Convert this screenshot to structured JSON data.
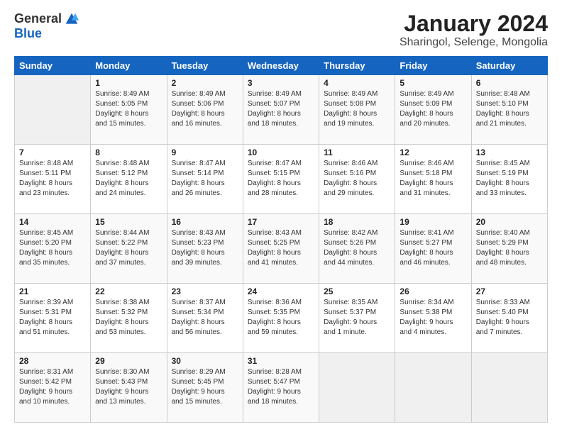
{
  "logo": {
    "general": "General",
    "blue": "Blue"
  },
  "title": "January 2024",
  "subtitle": "Sharingol, Selenge, Mongolia",
  "days_header": [
    "Sunday",
    "Monday",
    "Tuesday",
    "Wednesday",
    "Thursday",
    "Friday",
    "Saturday"
  ],
  "weeks": [
    [
      {
        "num": "",
        "sunrise": "",
        "sunset": "",
        "daylight": ""
      },
      {
        "num": "1",
        "sunrise": "Sunrise: 8:49 AM",
        "sunset": "Sunset: 5:05 PM",
        "daylight": "Daylight: 8 hours and 15 minutes."
      },
      {
        "num": "2",
        "sunrise": "Sunrise: 8:49 AM",
        "sunset": "Sunset: 5:06 PM",
        "daylight": "Daylight: 8 hours and 16 minutes."
      },
      {
        "num": "3",
        "sunrise": "Sunrise: 8:49 AM",
        "sunset": "Sunset: 5:07 PM",
        "daylight": "Daylight: 8 hours and 18 minutes."
      },
      {
        "num": "4",
        "sunrise": "Sunrise: 8:49 AM",
        "sunset": "Sunset: 5:08 PM",
        "daylight": "Daylight: 8 hours and 19 minutes."
      },
      {
        "num": "5",
        "sunrise": "Sunrise: 8:49 AM",
        "sunset": "Sunset: 5:09 PM",
        "daylight": "Daylight: 8 hours and 20 minutes."
      },
      {
        "num": "6",
        "sunrise": "Sunrise: 8:48 AM",
        "sunset": "Sunset: 5:10 PM",
        "daylight": "Daylight: 8 hours and 21 minutes."
      }
    ],
    [
      {
        "num": "7",
        "sunrise": "Sunrise: 8:48 AM",
        "sunset": "Sunset: 5:11 PM",
        "daylight": "Daylight: 8 hours and 23 minutes."
      },
      {
        "num": "8",
        "sunrise": "Sunrise: 8:48 AM",
        "sunset": "Sunset: 5:12 PM",
        "daylight": "Daylight: 8 hours and 24 minutes."
      },
      {
        "num": "9",
        "sunrise": "Sunrise: 8:47 AM",
        "sunset": "Sunset: 5:14 PM",
        "daylight": "Daylight: 8 hours and 26 minutes."
      },
      {
        "num": "10",
        "sunrise": "Sunrise: 8:47 AM",
        "sunset": "Sunset: 5:15 PM",
        "daylight": "Daylight: 8 hours and 28 minutes."
      },
      {
        "num": "11",
        "sunrise": "Sunrise: 8:46 AM",
        "sunset": "Sunset: 5:16 PM",
        "daylight": "Daylight: 8 hours and 29 minutes."
      },
      {
        "num": "12",
        "sunrise": "Sunrise: 8:46 AM",
        "sunset": "Sunset: 5:18 PM",
        "daylight": "Daylight: 8 hours and 31 minutes."
      },
      {
        "num": "13",
        "sunrise": "Sunrise: 8:45 AM",
        "sunset": "Sunset: 5:19 PM",
        "daylight": "Daylight: 8 hours and 33 minutes."
      }
    ],
    [
      {
        "num": "14",
        "sunrise": "Sunrise: 8:45 AM",
        "sunset": "Sunset: 5:20 PM",
        "daylight": "Daylight: 8 hours and 35 minutes."
      },
      {
        "num": "15",
        "sunrise": "Sunrise: 8:44 AM",
        "sunset": "Sunset: 5:22 PM",
        "daylight": "Daylight: 8 hours and 37 minutes."
      },
      {
        "num": "16",
        "sunrise": "Sunrise: 8:43 AM",
        "sunset": "Sunset: 5:23 PM",
        "daylight": "Daylight: 8 hours and 39 minutes."
      },
      {
        "num": "17",
        "sunrise": "Sunrise: 8:43 AM",
        "sunset": "Sunset: 5:25 PM",
        "daylight": "Daylight: 8 hours and 41 minutes."
      },
      {
        "num": "18",
        "sunrise": "Sunrise: 8:42 AM",
        "sunset": "Sunset: 5:26 PM",
        "daylight": "Daylight: 8 hours and 44 minutes."
      },
      {
        "num": "19",
        "sunrise": "Sunrise: 8:41 AM",
        "sunset": "Sunset: 5:27 PM",
        "daylight": "Daylight: 8 hours and 46 minutes."
      },
      {
        "num": "20",
        "sunrise": "Sunrise: 8:40 AM",
        "sunset": "Sunset: 5:29 PM",
        "daylight": "Daylight: 8 hours and 48 minutes."
      }
    ],
    [
      {
        "num": "21",
        "sunrise": "Sunrise: 8:39 AM",
        "sunset": "Sunset: 5:31 PM",
        "daylight": "Daylight: 8 hours and 51 minutes."
      },
      {
        "num": "22",
        "sunrise": "Sunrise: 8:38 AM",
        "sunset": "Sunset: 5:32 PM",
        "daylight": "Daylight: 8 hours and 53 minutes."
      },
      {
        "num": "23",
        "sunrise": "Sunrise: 8:37 AM",
        "sunset": "Sunset: 5:34 PM",
        "daylight": "Daylight: 8 hours and 56 minutes."
      },
      {
        "num": "24",
        "sunrise": "Sunrise: 8:36 AM",
        "sunset": "Sunset: 5:35 PM",
        "daylight": "Daylight: 8 hours and 59 minutes."
      },
      {
        "num": "25",
        "sunrise": "Sunrise: 8:35 AM",
        "sunset": "Sunset: 5:37 PM",
        "daylight": "Daylight: 9 hours and 1 minute."
      },
      {
        "num": "26",
        "sunrise": "Sunrise: 8:34 AM",
        "sunset": "Sunset: 5:38 PM",
        "daylight": "Daylight: 9 hours and 4 minutes."
      },
      {
        "num": "27",
        "sunrise": "Sunrise: 8:33 AM",
        "sunset": "Sunset: 5:40 PM",
        "daylight": "Daylight: 9 hours and 7 minutes."
      }
    ],
    [
      {
        "num": "28",
        "sunrise": "Sunrise: 8:31 AM",
        "sunset": "Sunset: 5:42 PM",
        "daylight": "Daylight: 9 hours and 10 minutes."
      },
      {
        "num": "29",
        "sunrise": "Sunrise: 8:30 AM",
        "sunset": "Sunset: 5:43 PM",
        "daylight": "Daylight: 9 hours and 13 minutes."
      },
      {
        "num": "30",
        "sunrise": "Sunrise: 8:29 AM",
        "sunset": "Sunset: 5:45 PM",
        "daylight": "Daylight: 9 hours and 15 minutes."
      },
      {
        "num": "31",
        "sunrise": "Sunrise: 8:28 AM",
        "sunset": "Sunset: 5:47 PM",
        "daylight": "Daylight: 9 hours and 18 minutes."
      },
      {
        "num": "",
        "sunrise": "",
        "sunset": "",
        "daylight": ""
      },
      {
        "num": "",
        "sunrise": "",
        "sunset": "",
        "daylight": ""
      },
      {
        "num": "",
        "sunrise": "",
        "sunset": "",
        "daylight": ""
      }
    ]
  ]
}
